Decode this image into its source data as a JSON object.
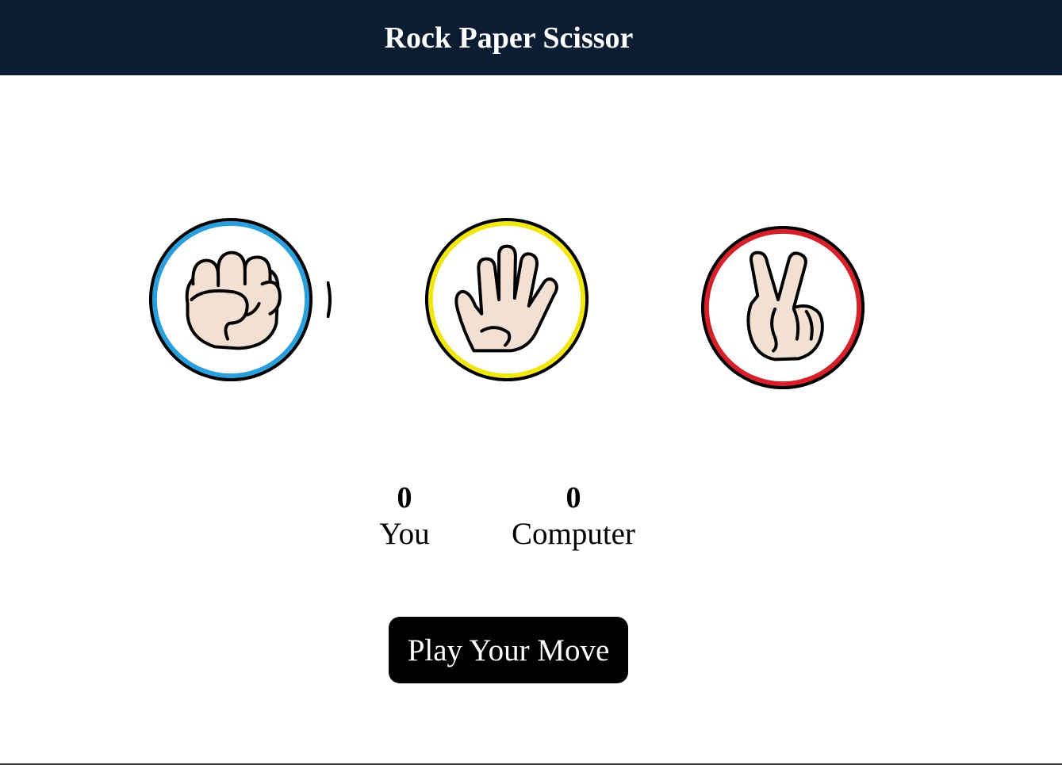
{
  "header": {
    "title": "Rock Paper Scissor"
  },
  "choices": [
    {
      "name": "rock",
      "icon": "fist-icon",
      "ring_color": "#2a9fdb"
    },
    {
      "name": "paper",
      "icon": "open-hand-icon",
      "ring_color": "#f2e612"
    },
    {
      "name": "scissor",
      "icon": "peace-sign-icon",
      "ring_color": "#d6202a"
    }
  ],
  "scoreboard": {
    "you": {
      "score": "0",
      "label": "You"
    },
    "computer": {
      "score": "0",
      "label": "Computer"
    }
  },
  "play_button": {
    "label": "Play Your Move"
  },
  "colors": {
    "header_bg": "#0b1d33",
    "skin": "#f2e0d2",
    "button_bg": "#000000"
  }
}
